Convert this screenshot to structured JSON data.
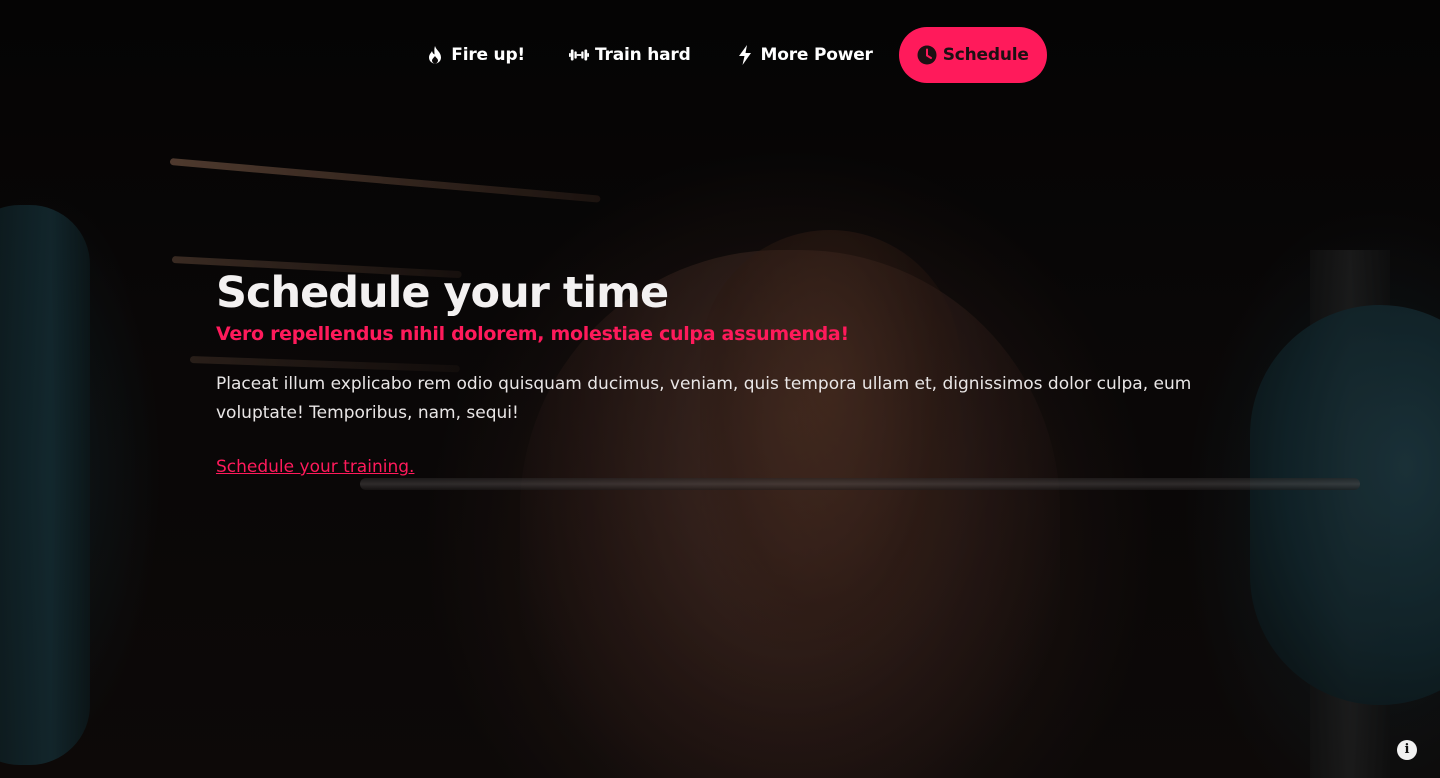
{
  "nav": {
    "items": [
      {
        "label": "Fire up!",
        "icon": "flame-icon",
        "active": false
      },
      {
        "label": "Train hard",
        "icon": "dumbbell-icon",
        "active": false
      },
      {
        "label": "More Power",
        "icon": "lightning-bolt-icon",
        "active": false
      },
      {
        "label": "Schedule",
        "icon": "clock-icon",
        "active": true
      }
    ]
  },
  "hero": {
    "title": "Schedule your time",
    "subtitle": "Vero repellendus nihil dolorem, molestiae culpa assumenda!",
    "body": "Placeat illum explicabo rem odio quisquam ducimus, veniam, quis tempora ullam et, dignissimos dolor culpa, eum voluptate! Temporibus, nam, sequi!",
    "cta_label": "Schedule your training."
  },
  "info_button": {
    "icon": "info-icon",
    "glyph": "i"
  },
  "colors": {
    "accent": "#ff1a5b",
    "text": "#f3f1f1",
    "background": "#0b0909"
  }
}
